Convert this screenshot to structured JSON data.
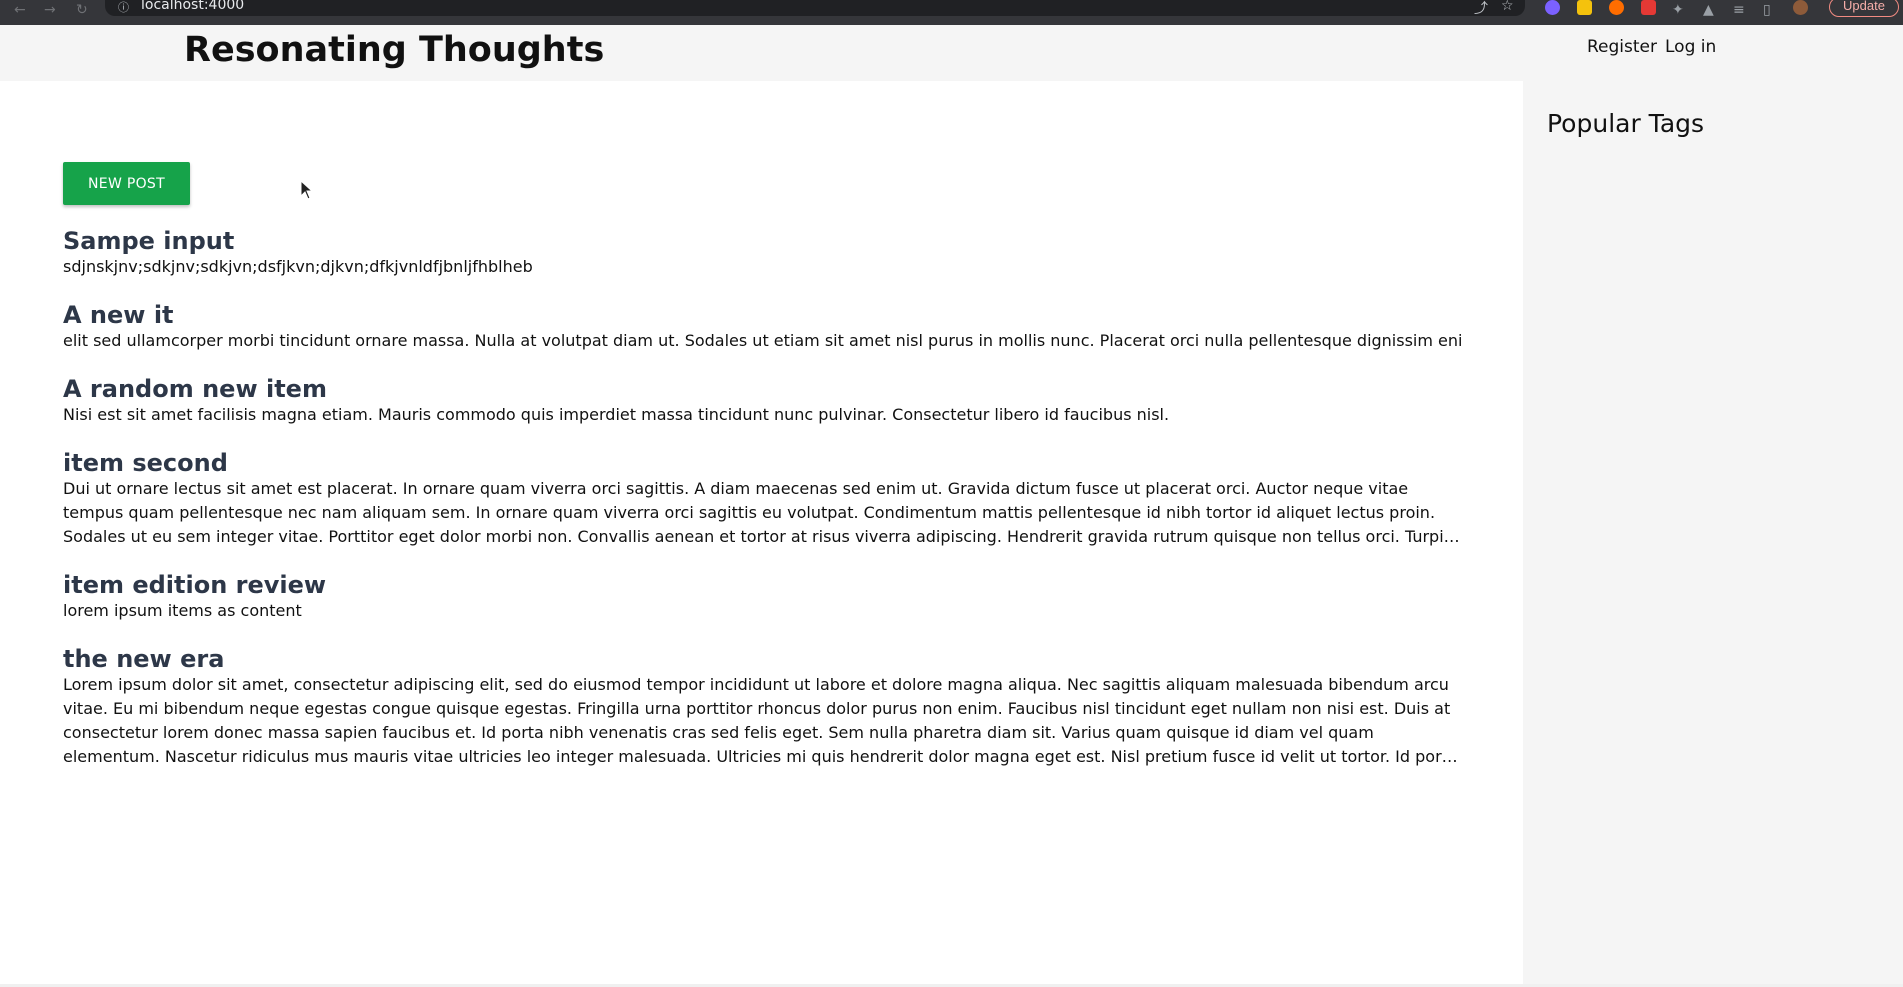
{
  "browser": {
    "url": "localhost:4000",
    "update_label": "Update",
    "extension_colors": [
      "#7b61ff",
      "#f4c20d",
      "#ff6d00",
      "#e53935"
    ]
  },
  "header": {
    "site_title": "Resonating Thoughts",
    "register_label": "Register",
    "login_label": "Log in"
  },
  "main": {
    "new_post_label": "NEW POST",
    "posts": [
      {
        "title": "Sampe input",
        "excerpt": "sdjnskjnv;sdkjnv;sdkjvn;dsfjkvn;djkvn;dfkjvnldfjbnljfhblheb"
      },
      {
        "title": "A new it",
        "excerpt": "elit sed ullamcorper morbi tincidunt ornare massa. Nulla at volutpat diam ut. Sodales ut etiam sit amet nisl purus in mollis nunc. Placerat orci nulla pellentesque dignissim enim. Turpis in"
      },
      {
        "title": "A random new item",
        "excerpt": "Nisi est sit amet facilisis magna etiam. Mauris commodo quis imperdiet massa tincidunt nunc pulvinar. Consectetur libero id faucibus nisl."
      },
      {
        "title": "item second",
        "excerpt": "Dui ut ornare lectus sit amet est placerat. In ornare quam viverra orci sagittis. A diam maecenas sed enim ut. Gravida dictum fusce ut placerat orci. Auctor neque vitae tempus quam pellentesque nec nam aliquam sem. In ornare quam viverra orci sagittis eu volutpat. Condimentum mattis pellentesque id nibh tortor id aliquet lectus proin. Sodales ut eu sem integer vitae. Porttitor eget dolor morbi non. Convallis aenean et tortor at risus viverra adipiscing. Hendrerit gravida rutrum quisque non tellus orci. Turpis tincidunt id aliquet risus feugiat."
      },
      {
        "title": "item edition review",
        "excerpt": "lorem ipsum items as content"
      },
      {
        "title": "the new era",
        "excerpt": "Lorem ipsum dolor sit amet, consectetur adipiscing elit, sed do eiusmod tempor incididunt ut labore et dolore magna aliqua. Nec sagittis aliquam malesuada bibendum arcu vitae. Eu mi bibendum neque egestas congue quisque egestas. Fringilla urna porttitor rhoncus dolor purus non enim. Faucibus nisl tincidunt eget nullam non nisi est. Duis at consectetur lorem donec massa sapien faucibus et. Id porta nibh venenatis cras sed felis eget. Sem nulla pharetra diam sit. Varius quam quisque id diam vel quam elementum. Nascetur ridiculus mus mauris vitae ultricies leo integer malesuada. Ultricies mi quis hendrerit dolor magna eget est. Nisl pretium fusce id velit ut tortor. Id porta nibh venenatis cras sed felis eget velit aliquet...."
      }
    ]
  },
  "sidebar": {
    "title": "Popular Tags"
  },
  "colors": {
    "accent_green": "#16a34a",
    "header_bg": "#f5f5f5",
    "post_title": "#2d3748"
  }
}
